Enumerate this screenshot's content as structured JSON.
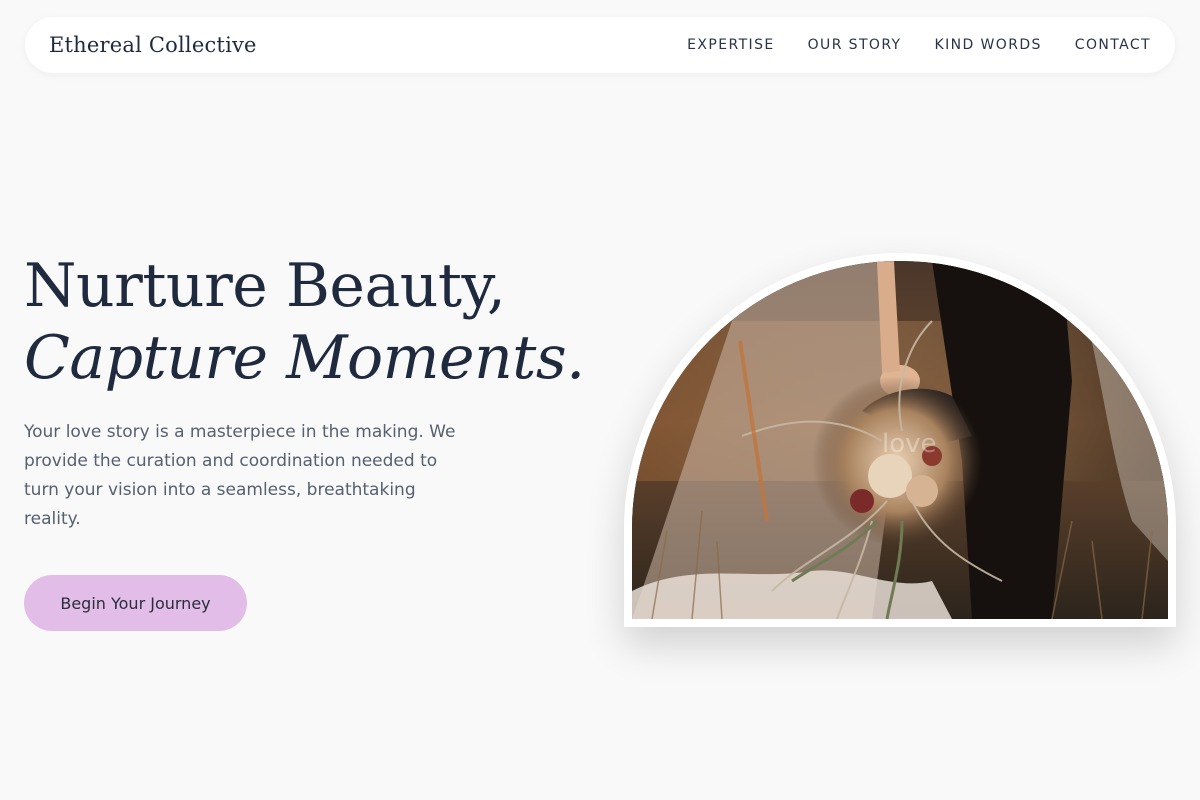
{
  "header": {
    "brand": "Ethereal Collective",
    "nav": [
      {
        "label": "EXPERTISE"
      },
      {
        "label": "OUR STORY"
      },
      {
        "label": "KIND WORDS"
      },
      {
        "label": "CONTACT"
      }
    ]
  },
  "hero": {
    "title_line1": "Nurture Beauty,",
    "title_line2": "Capture Moments.",
    "description": "Your love story is a masterpiece in the making. We provide the curation and coordination needed to turn your vision into a seamless, breathtaking reality.",
    "cta_label": "Begin Your Journey",
    "image_overlay_text": "love"
  },
  "colors": {
    "background": "#f9f9f9",
    "heading": "#1f2a3f",
    "body_text": "#56606f",
    "cta_background": "#e2bde8",
    "nav_background": "#ffffff"
  }
}
